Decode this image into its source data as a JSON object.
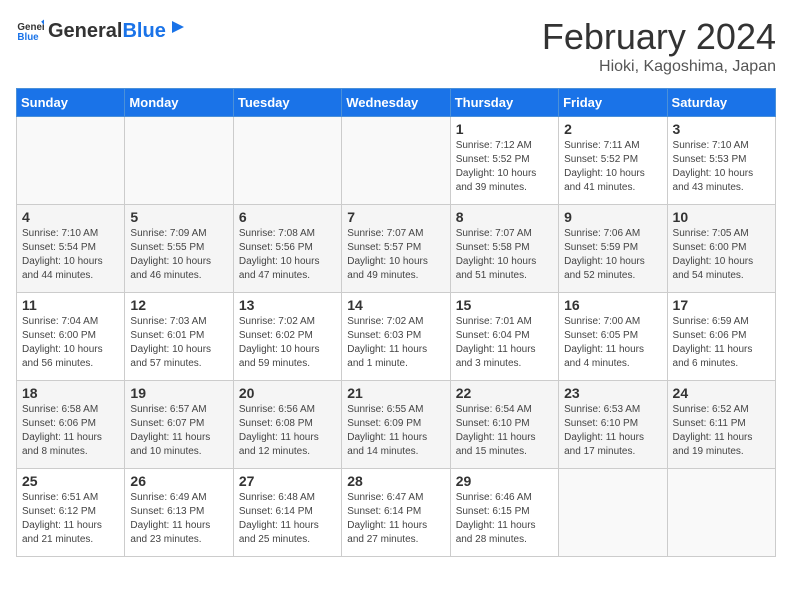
{
  "header": {
    "logo_general": "General",
    "logo_blue": "Blue",
    "title": "February 2024",
    "subtitle": "Hioki, Kagoshima, Japan"
  },
  "weekdays": [
    "Sunday",
    "Monday",
    "Tuesday",
    "Wednesday",
    "Thursday",
    "Friday",
    "Saturday"
  ],
  "weeks": [
    [
      {
        "day": "",
        "info": ""
      },
      {
        "day": "",
        "info": ""
      },
      {
        "day": "",
        "info": ""
      },
      {
        "day": "",
        "info": ""
      },
      {
        "day": "1",
        "info": "Sunrise: 7:12 AM\nSunset: 5:52 PM\nDaylight: 10 hours\nand 39 minutes."
      },
      {
        "day": "2",
        "info": "Sunrise: 7:11 AM\nSunset: 5:52 PM\nDaylight: 10 hours\nand 41 minutes."
      },
      {
        "day": "3",
        "info": "Sunrise: 7:10 AM\nSunset: 5:53 PM\nDaylight: 10 hours\nand 43 minutes."
      }
    ],
    [
      {
        "day": "4",
        "info": "Sunrise: 7:10 AM\nSunset: 5:54 PM\nDaylight: 10 hours\nand 44 minutes."
      },
      {
        "day": "5",
        "info": "Sunrise: 7:09 AM\nSunset: 5:55 PM\nDaylight: 10 hours\nand 46 minutes."
      },
      {
        "day": "6",
        "info": "Sunrise: 7:08 AM\nSunset: 5:56 PM\nDaylight: 10 hours\nand 47 minutes."
      },
      {
        "day": "7",
        "info": "Sunrise: 7:07 AM\nSunset: 5:57 PM\nDaylight: 10 hours\nand 49 minutes."
      },
      {
        "day": "8",
        "info": "Sunrise: 7:07 AM\nSunset: 5:58 PM\nDaylight: 10 hours\nand 51 minutes."
      },
      {
        "day": "9",
        "info": "Sunrise: 7:06 AM\nSunset: 5:59 PM\nDaylight: 10 hours\nand 52 minutes."
      },
      {
        "day": "10",
        "info": "Sunrise: 7:05 AM\nSunset: 6:00 PM\nDaylight: 10 hours\nand 54 minutes."
      }
    ],
    [
      {
        "day": "11",
        "info": "Sunrise: 7:04 AM\nSunset: 6:00 PM\nDaylight: 10 hours\nand 56 minutes."
      },
      {
        "day": "12",
        "info": "Sunrise: 7:03 AM\nSunset: 6:01 PM\nDaylight: 10 hours\nand 57 minutes."
      },
      {
        "day": "13",
        "info": "Sunrise: 7:02 AM\nSunset: 6:02 PM\nDaylight: 10 hours\nand 59 minutes."
      },
      {
        "day": "14",
        "info": "Sunrise: 7:02 AM\nSunset: 6:03 PM\nDaylight: 11 hours\nand 1 minute."
      },
      {
        "day": "15",
        "info": "Sunrise: 7:01 AM\nSunset: 6:04 PM\nDaylight: 11 hours\nand 3 minutes."
      },
      {
        "day": "16",
        "info": "Sunrise: 7:00 AM\nSunset: 6:05 PM\nDaylight: 11 hours\nand 4 minutes."
      },
      {
        "day": "17",
        "info": "Sunrise: 6:59 AM\nSunset: 6:06 PM\nDaylight: 11 hours\nand 6 minutes."
      }
    ],
    [
      {
        "day": "18",
        "info": "Sunrise: 6:58 AM\nSunset: 6:06 PM\nDaylight: 11 hours\nand 8 minutes."
      },
      {
        "day": "19",
        "info": "Sunrise: 6:57 AM\nSunset: 6:07 PM\nDaylight: 11 hours\nand 10 minutes."
      },
      {
        "day": "20",
        "info": "Sunrise: 6:56 AM\nSunset: 6:08 PM\nDaylight: 11 hours\nand 12 minutes."
      },
      {
        "day": "21",
        "info": "Sunrise: 6:55 AM\nSunset: 6:09 PM\nDaylight: 11 hours\nand 14 minutes."
      },
      {
        "day": "22",
        "info": "Sunrise: 6:54 AM\nSunset: 6:10 PM\nDaylight: 11 hours\nand 15 minutes."
      },
      {
        "day": "23",
        "info": "Sunrise: 6:53 AM\nSunset: 6:10 PM\nDaylight: 11 hours\nand 17 minutes."
      },
      {
        "day": "24",
        "info": "Sunrise: 6:52 AM\nSunset: 6:11 PM\nDaylight: 11 hours\nand 19 minutes."
      }
    ],
    [
      {
        "day": "25",
        "info": "Sunrise: 6:51 AM\nSunset: 6:12 PM\nDaylight: 11 hours\nand 21 minutes."
      },
      {
        "day": "26",
        "info": "Sunrise: 6:49 AM\nSunset: 6:13 PM\nDaylight: 11 hours\nand 23 minutes."
      },
      {
        "day": "27",
        "info": "Sunrise: 6:48 AM\nSunset: 6:14 PM\nDaylight: 11 hours\nand 25 minutes."
      },
      {
        "day": "28",
        "info": "Sunrise: 6:47 AM\nSunset: 6:14 PM\nDaylight: 11 hours\nand 27 minutes."
      },
      {
        "day": "29",
        "info": "Sunrise: 6:46 AM\nSunset: 6:15 PM\nDaylight: 11 hours\nand 28 minutes."
      },
      {
        "day": "",
        "info": ""
      },
      {
        "day": "",
        "info": ""
      }
    ]
  ]
}
